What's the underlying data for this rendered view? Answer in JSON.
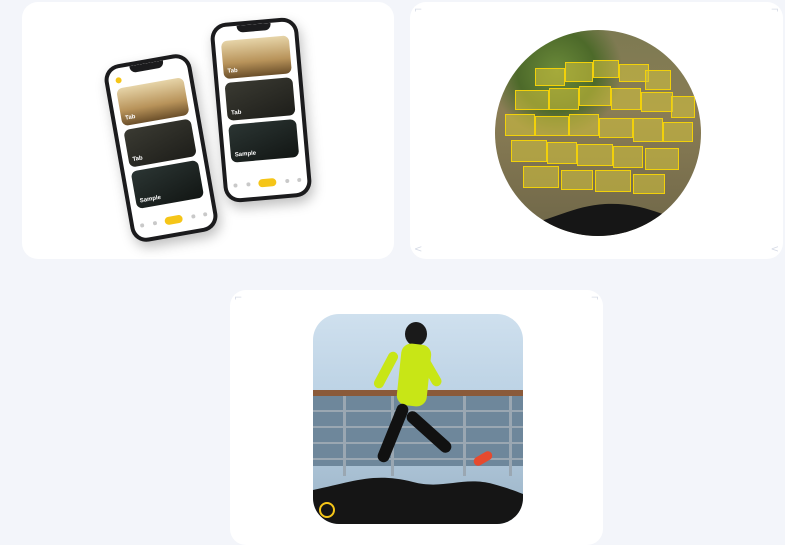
{
  "page": {
    "background": "#f3f5fa"
  },
  "colors": {
    "accent": "#f5c518",
    "card": "#ffffff",
    "detection_box": "#f2d10a"
  },
  "cards": [
    {
      "name": "mobile-app-mockup",
      "icon": "phone-mockup"
    },
    {
      "name": "object-detection-sample",
      "icon": "detection-circle"
    },
    {
      "name": "person-segmentation-sample",
      "icon": "runner-image"
    }
  ],
  "phone_left": {
    "panels": [
      {
        "title": "Tab",
        "subtitle": ""
      },
      {
        "title": "Tab",
        "subtitle": ""
      },
      {
        "title": "Sample",
        "subtitle": ""
      }
    ]
  },
  "phone_right": {
    "panels": [
      {
        "title": "Tab",
        "subtitle": ""
      },
      {
        "title": "Tab",
        "subtitle": ""
      },
      {
        "title": "Sample",
        "subtitle": ""
      }
    ]
  },
  "icons": [
    "yellow-ring-icon"
  ]
}
